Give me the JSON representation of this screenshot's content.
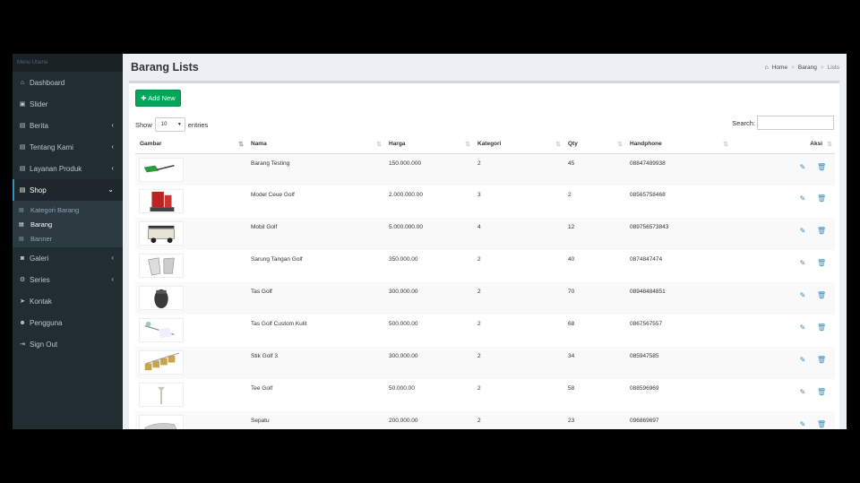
{
  "sidebar": {
    "header": "Menu Utama",
    "items": [
      {
        "label": "Dashboard",
        "icon": "home-icon",
        "glyph": "⌂",
        "chevron": false
      },
      {
        "label": "Slider",
        "icon": "image-icon",
        "glyph": "▣",
        "chevron": false
      },
      {
        "label": "Berita",
        "icon": "list-icon",
        "glyph": "▤",
        "chevron": true
      },
      {
        "label": "Tentang Kami",
        "icon": "list-icon",
        "glyph": "▤",
        "chevron": true
      },
      {
        "label": "Layanan Produk",
        "icon": "list-icon",
        "glyph": "▤",
        "chevron": true
      },
      {
        "label": "Shop",
        "icon": "list-icon",
        "glyph": "▤",
        "chevron": true,
        "active": true
      },
      {
        "label": "Galeri",
        "icon": "camera-icon",
        "glyph": "◙",
        "chevron": true
      },
      {
        "label": "Series",
        "icon": "gear-icon",
        "glyph": "⚙",
        "chevron": true
      },
      {
        "label": "Kontak",
        "icon": "paper-plane-icon",
        "glyph": "➤",
        "chevron": false
      },
      {
        "label": "Pengguna",
        "icon": "users-icon",
        "glyph": "☻",
        "chevron": false
      },
      {
        "label": "Sign Out",
        "icon": "sign-out-icon",
        "glyph": "⇥",
        "chevron": false
      }
    ],
    "shop_submenu": [
      "Kategori Barang",
      "Barang",
      "Banner"
    ]
  },
  "header": {
    "title": "Barang Lists",
    "breadcrumb": [
      "Home",
      "Barang",
      "Lists"
    ]
  },
  "toolbar": {
    "add_label": "✚ Add New",
    "show_label": "Show",
    "entries_value": "10",
    "entries_label": "entries",
    "search_label": "Search:"
  },
  "table": {
    "columns": [
      "Gambar",
      "Nama",
      "Harga",
      "Kategori",
      "Qty",
      "Handphone",
      "Aksi"
    ],
    "rows": [
      {
        "nama": "Barang Testing",
        "harga": "150.000.000",
        "kategori": "2",
        "qty": "45",
        "hp": "08847489938"
      },
      {
        "nama": "Model Ceue Golf",
        "harga": "2.000.000.00",
        "kategori": "3",
        "qty": "2",
        "hp": "08565758468"
      },
      {
        "nama": "Mobil Golf",
        "harga": "5.000.000.00",
        "kategori": "4",
        "qty": "12",
        "hp": "089756573843"
      },
      {
        "nama": "Sarung Tangan Golf",
        "harga": "350.000.00",
        "kategori": "2",
        "qty": "40",
        "hp": "0874847474"
      },
      {
        "nama": "Tas Golf",
        "harga": "300.000.00",
        "kategori": "2",
        "qty": "70",
        "hp": "08948484851"
      },
      {
        "nama": "Tas Golf Custom Kulit",
        "harga": "500.000.00",
        "kategori": "2",
        "qty": "68",
        "hp": "0867567557"
      },
      {
        "nama": "Stik Golf 3",
        "harga": "300.000.00",
        "kategori": "2",
        "qty": "34",
        "hp": "085947585"
      },
      {
        "nama": "Tee Golf",
        "harga": "50.000.00",
        "kategori": "2",
        "qty": "58",
        "hp": "088596969"
      },
      {
        "nama": "Sepatu",
        "harga": "200.000.00",
        "kategori": "2",
        "qty": "23",
        "hp": "096869697"
      }
    ]
  },
  "colors": {
    "sidebar": "#222d32",
    "accent": "#3c8dbc",
    "success": "#00a65a"
  }
}
